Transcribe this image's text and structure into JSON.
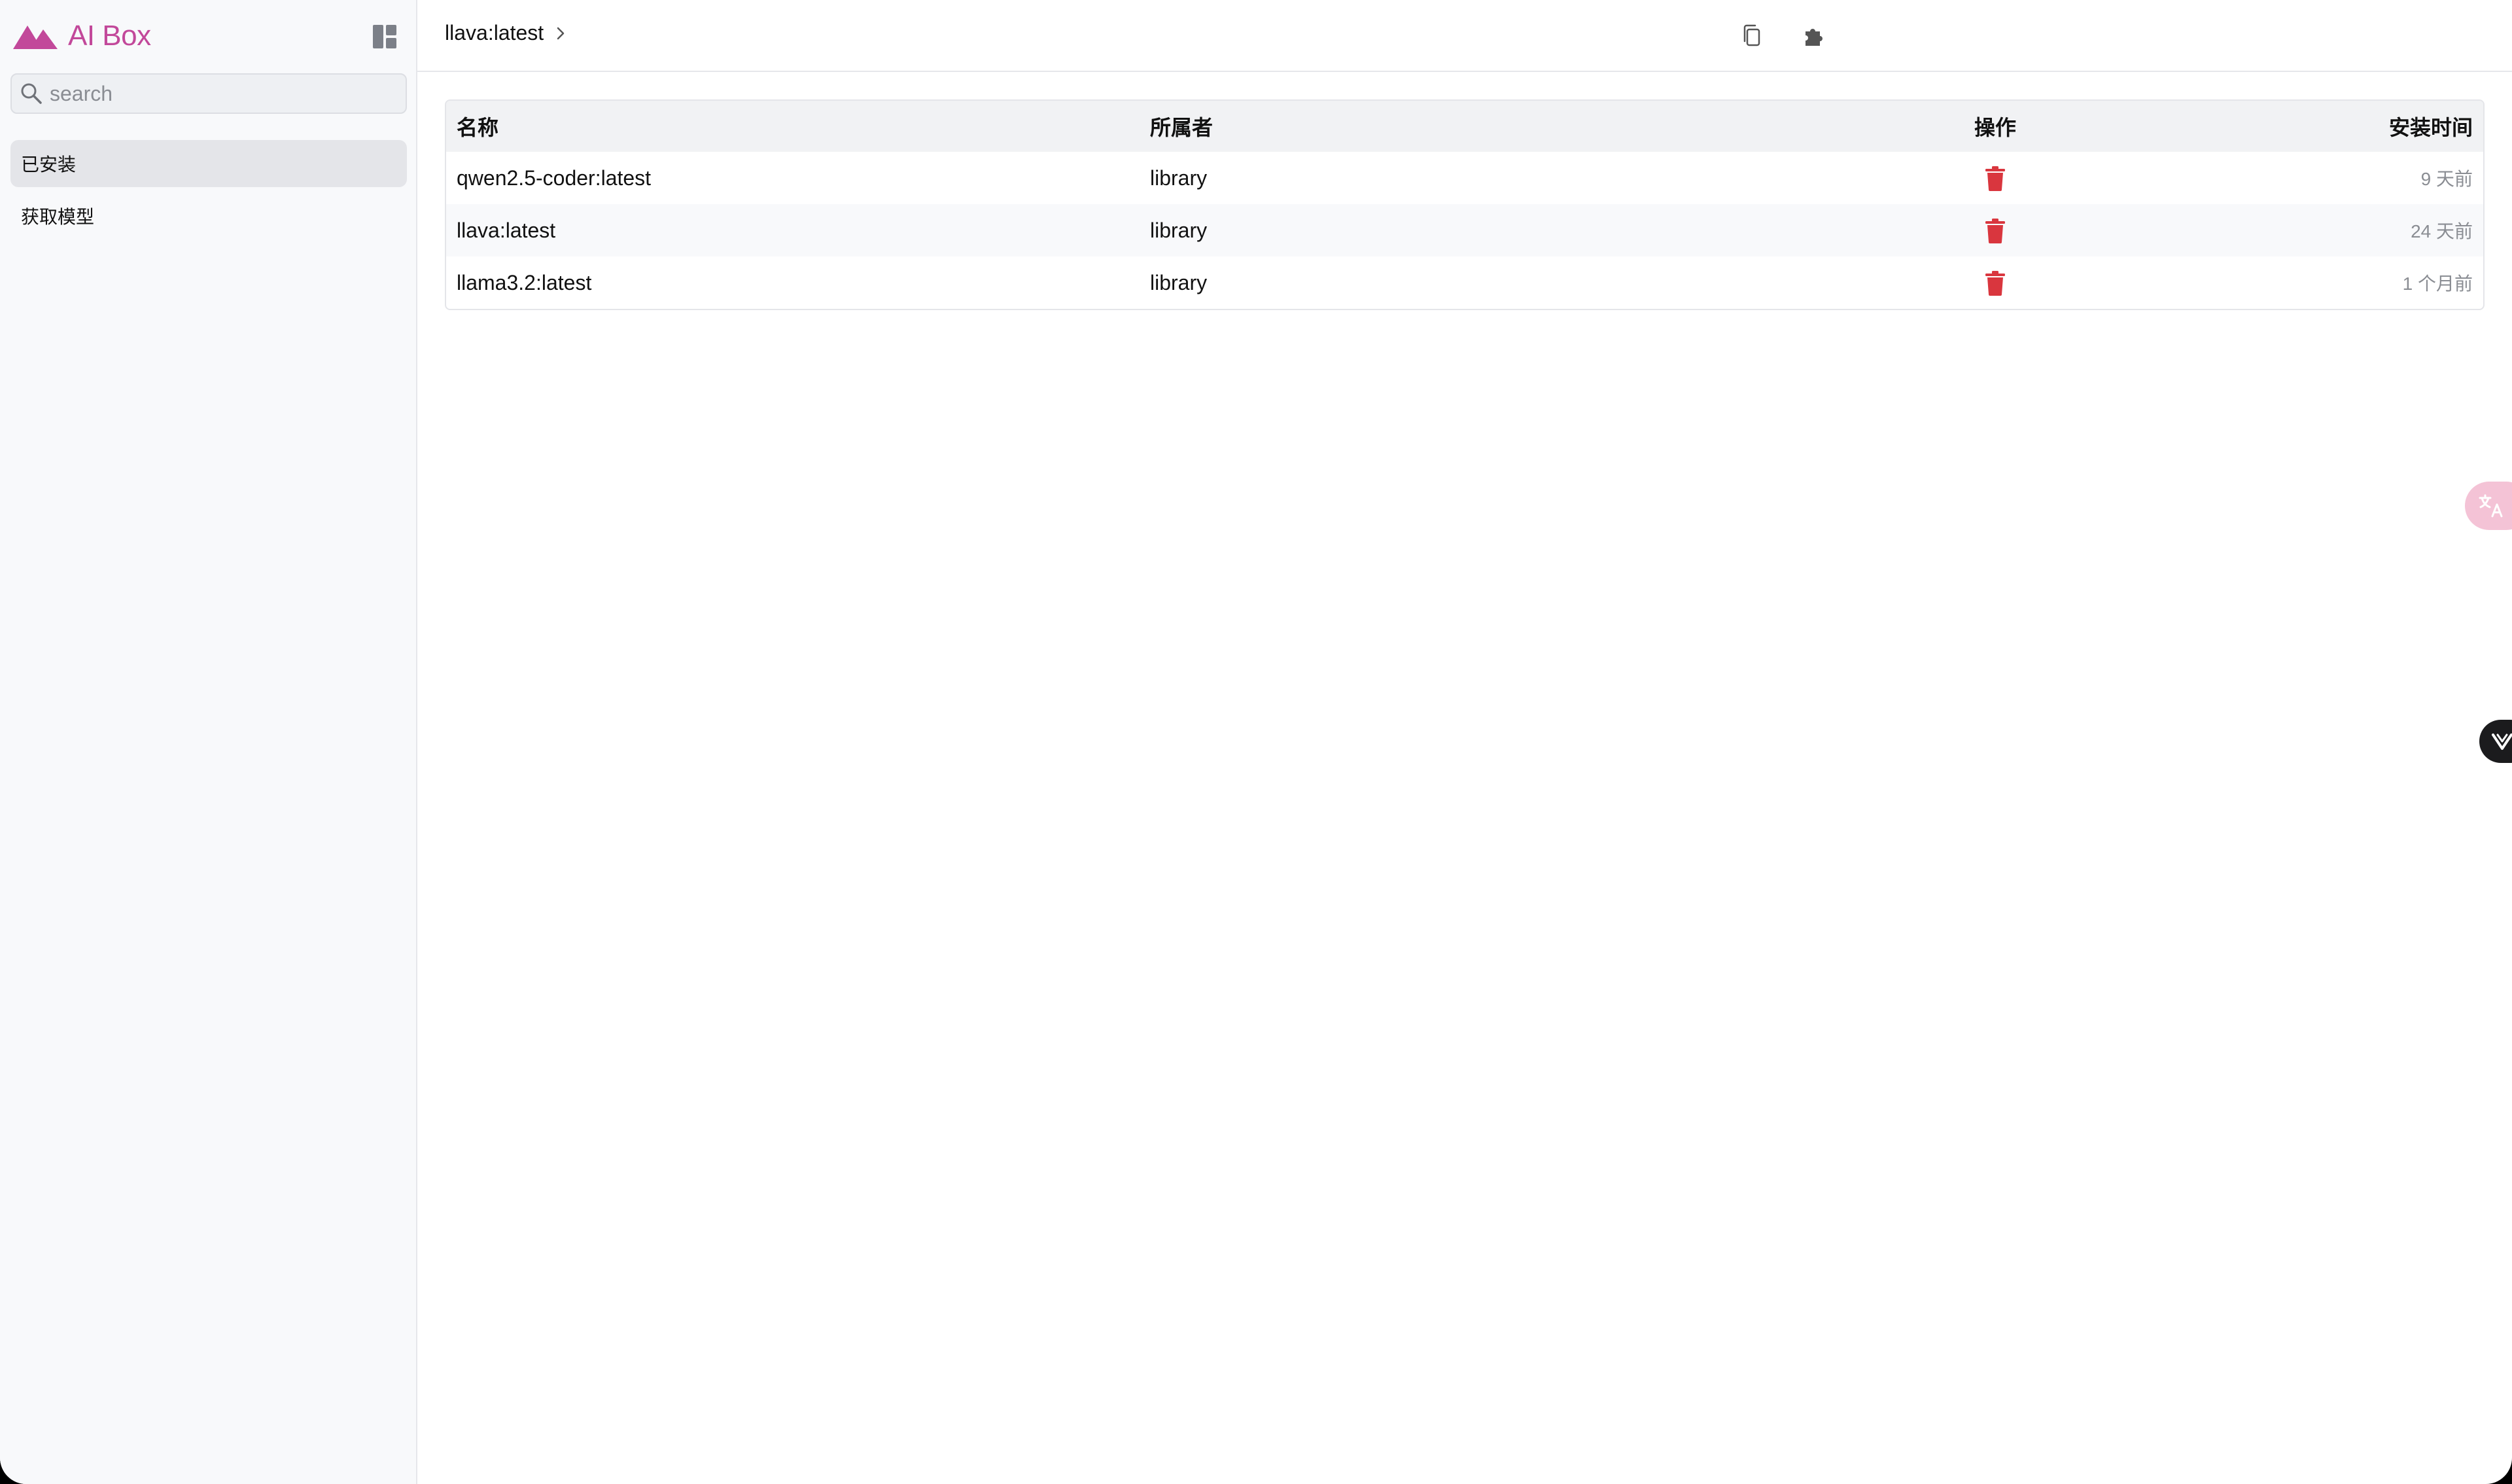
{
  "app": {
    "name": "AI Box",
    "brand_color": "#c2489a"
  },
  "search": {
    "placeholder": "search"
  },
  "sidebar": {
    "items": [
      {
        "label": "已安装",
        "active": true
      },
      {
        "label": "获取模型",
        "active": false
      }
    ]
  },
  "header": {
    "breadcrumb": "llava:latest"
  },
  "table": {
    "columns": [
      "名称",
      "所属者",
      "操作",
      "安装时间"
    ],
    "rows": [
      {
        "name": "qwen2.5-coder:latest",
        "owner": "library",
        "installed": "9 天前"
      },
      {
        "name": "llava:latest",
        "owner": "library",
        "installed": "24 天前"
      },
      {
        "name": "llama3.2:latest",
        "owner": "library",
        "installed": "1 个月前"
      }
    ]
  },
  "icons": {
    "logo": "mountains-icon",
    "layout_toggle": "layout-panel-icon",
    "search": "search-icon",
    "breadcrumb_chevron": "chevron-right-icon",
    "copy": "copy-icon",
    "extension": "puzzle-icon",
    "delete": "trash-icon",
    "translate": "translate-icon",
    "dark_widget": "v-icon"
  },
  "colors": {
    "delete": "#d9363e",
    "translate_fab": "#f4c3d6"
  }
}
